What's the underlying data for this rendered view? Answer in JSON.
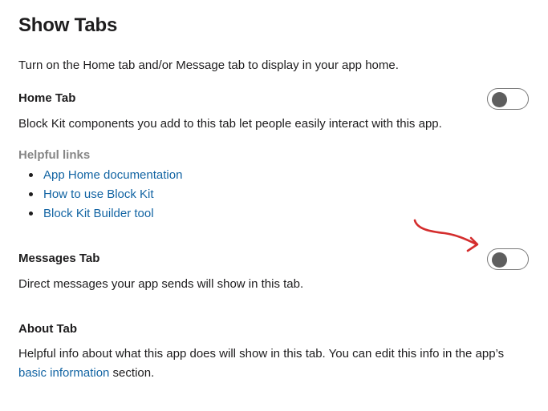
{
  "page": {
    "title": "Show Tabs",
    "intro": "Turn on the Home tab and/or Message tab to display in your app home."
  },
  "home_tab": {
    "heading": "Home Tab",
    "description": "Block Kit components you add to this tab let people easily interact with this app.",
    "enabled": false
  },
  "helpful_links": {
    "label": "Helpful links",
    "items": [
      {
        "label": "App Home documentation"
      },
      {
        "label": "How to use Block Kit"
      },
      {
        "label": "Block Kit Builder tool"
      }
    ]
  },
  "messages_tab": {
    "heading": "Messages Tab",
    "description": "Direct messages your app sends will show in this tab.",
    "enabled": false
  },
  "about_tab": {
    "heading": "About Tab",
    "description_before": "Helpful info about what this app does will show in this tab. You can edit this info in the app’s ",
    "link_label": "basic information",
    "description_after": " section."
  },
  "colors": {
    "link": "#1264a3",
    "text": "#1d1c1d",
    "muted": "#868686",
    "annotation_arrow": "#d42d2d"
  }
}
